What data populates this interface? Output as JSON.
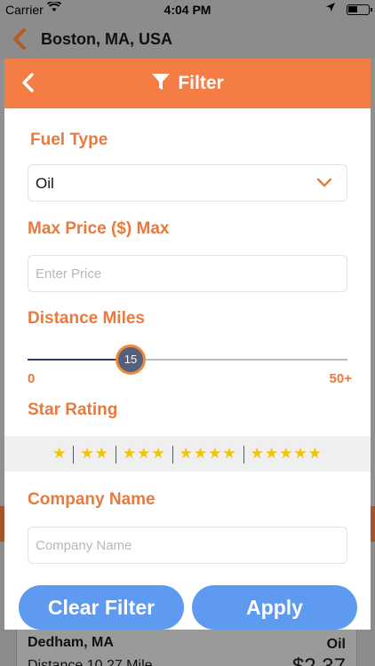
{
  "status_bar": {
    "carrier": "Carrier",
    "time": "4:04 PM"
  },
  "background": {
    "nav_title": "Boston, MA, USA",
    "card": {
      "city": "Dedham, MA",
      "fuel": "Oil",
      "distance": "Distance 10.27 Mile",
      "price": "$2.37"
    }
  },
  "modal": {
    "title": "Filter",
    "fuel_type": {
      "label": "Fuel Type",
      "value": "Oil"
    },
    "max_price": {
      "label": "Max Price ($) Max",
      "placeholder": "Enter Price"
    },
    "distance": {
      "label": "Distance Miles",
      "value": 15,
      "min_label": "0",
      "max_label": "50+",
      "min": 0,
      "max": 50
    },
    "star_rating": {
      "label": "Star Rating",
      "options": [
        "★",
        "★★",
        "★★★",
        "★★★★",
        "★★★★★"
      ]
    },
    "company_name": {
      "label": "Company Name",
      "placeholder": "Company Name"
    },
    "buttons": {
      "clear": "Clear Filter",
      "apply": "Apply"
    }
  },
  "colors": {
    "accent": "#f47d45",
    "label": "#e87a3e",
    "button": "#5e9bf0",
    "star": "#f4c400",
    "slider_thumb": "#55607d"
  },
  "icons": [
    "wifi-icon",
    "location-arrow-icon",
    "battery-icon",
    "chevron-left-icon",
    "filter-funnel-icon",
    "chevron-down-icon",
    "star-icon"
  ]
}
